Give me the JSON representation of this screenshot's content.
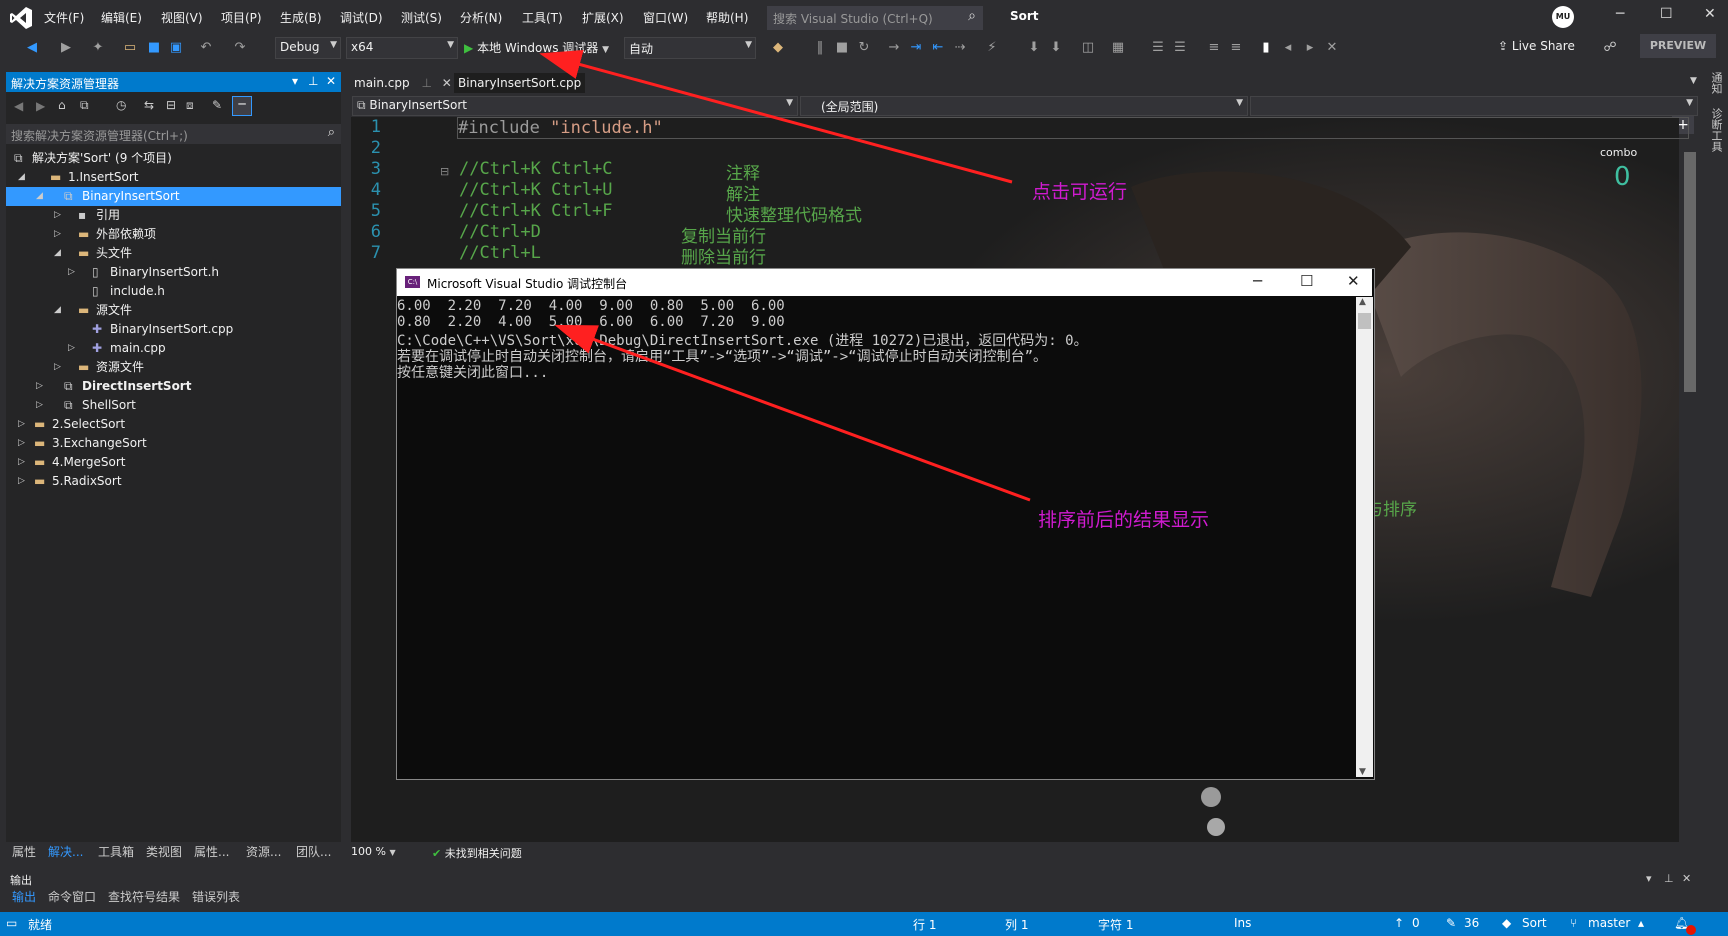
{
  "menu": {
    "items": [
      "文件(F)",
      "编辑(E)",
      "视图(V)",
      "项目(P)",
      "生成(B)",
      "调试(D)",
      "测试(S)",
      "分析(N)",
      "工具(T)",
      "扩展(X)",
      "窗口(W)",
      "帮助(H)"
    ],
    "search_placeholder": "搜索 Visual Studio (Ctrl+Q)",
    "solution_name": "Sort",
    "avatar_text": "MU"
  },
  "toolbar": {
    "config": "Debug",
    "platform": "x64",
    "run_label": "本地 Windows 调试器",
    "run_mode": "自动",
    "live_share": "Live Share",
    "preview": "PREVIEW"
  },
  "solution_explorer": {
    "title": "解决方案资源管理器",
    "search_placeholder": "搜索解决方案资源管理器(Ctrl+;)",
    "tree": [
      {
        "label": "解决方案'Sort' (9 个项目)",
        "icon": "solution-icon",
        "arrow": "",
        "bold": false,
        "selected": false
      },
      {
        "label": "1.InsertSort",
        "icon": "folder-icon",
        "arrow": "◢",
        "bold": false,
        "selected": false
      },
      {
        "label": "BinaryInsertSort",
        "icon": "project-icon",
        "arrow": "◢",
        "bold": false,
        "selected": true
      },
      {
        "label": "引用",
        "icon": "references-icon",
        "arrow": "▷",
        "bold": false,
        "selected": false
      },
      {
        "label": "外部依赖项",
        "icon": "folder-icon",
        "arrow": "▷",
        "bold": false,
        "selected": false
      },
      {
        "label": "头文件",
        "icon": "folder-icon",
        "arrow": "◢",
        "bold": false,
        "selected": false
      },
      {
        "label": "BinaryInsertSort.h",
        "icon": "header-file-icon",
        "arrow": "▷",
        "bold": false,
        "selected": false
      },
      {
        "label": "include.h",
        "icon": "header-file-icon",
        "arrow": "",
        "bold": false,
        "selected": false
      },
      {
        "label": "源文件",
        "icon": "folder-icon",
        "arrow": "◢",
        "bold": false,
        "selected": false
      },
      {
        "label": "BinaryInsertSort.cpp",
        "icon": "cpp-file-icon",
        "arrow": "",
        "bold": false,
        "selected": false
      },
      {
        "label": "main.cpp",
        "icon": "cpp-file-icon",
        "arrow": "▷",
        "bold": false,
        "selected": false
      },
      {
        "label": "资源文件",
        "icon": "folder-icon",
        "arrow": "▷",
        "bold": false,
        "selected": false
      },
      {
        "label": "DirectInsertSort",
        "icon": "project-icon",
        "arrow": "▷",
        "bold": true,
        "selected": false
      },
      {
        "label": "ShellSort",
        "icon": "project-icon",
        "arrow": "▷",
        "bold": false,
        "selected": false
      },
      {
        "label": "2.SelectSort",
        "icon": "folder-icon",
        "arrow": "▷",
        "bold": false,
        "selected": false
      },
      {
        "label": "3.ExchangeSort",
        "icon": "folder-icon",
        "arrow": "▷",
        "bold": false,
        "selected": false
      },
      {
        "label": "4.MergeSort",
        "icon": "folder-icon",
        "arrow": "▷",
        "bold": false,
        "selected": false
      },
      {
        "label": "5.RadixSort",
        "icon": "folder-icon",
        "arrow": "▷",
        "bold": false,
        "selected": false
      }
    ],
    "bottom_tabs": [
      "属性",
      "解决...",
      "工具箱",
      "类视图",
      "属性...",
      "资源...",
      "团队..."
    ]
  },
  "editor": {
    "tabs": [
      "main.cpp",
      "BinaryInsertSort.cpp"
    ],
    "nav_left": "BinaryInsertSort",
    "nav_mid": "(全局范围)",
    "line_numbers": [
      "1",
      "2",
      "3",
      "4",
      "5",
      "6",
      "7"
    ],
    "code_include_kw": "#include ",
    "code_include_str": "\"include.h\"",
    "code_lines": [
      {
        "key": "//Ctrl+K Ctrl+C",
        "desc": "注释"
      },
      {
        "key": "//Ctrl+K Ctrl+U",
        "desc": "解注"
      },
      {
        "key": "//Ctrl+K Ctrl+F",
        "desc": "快速整理代码格式"
      },
      {
        "key": "//Ctrl+D",
        "desc": "复制当前行"
      },
      {
        "key": "//Ctrl+L",
        "desc": "删除当前行"
      }
    ],
    "combo_label": "combo",
    "combo_value": "0",
    "bg_text": "与排序",
    "zoom": "100 %",
    "issues": "未找到相关问题"
  },
  "console": {
    "title": "Microsoft Visual Studio 调试控制台",
    "lines": [
      "6.00  2.20  7.20  4.00  9.00  0.80  5.00  6.00",
      "0.80  2.20  4.00  5.00  6.00  6.00  7.20  9.00",
      "C:\\Code\\C++\\VS\\Sort\\x64\\Debug\\DirectInsertSort.exe (进程 10272)已退出，返回代码为: 0。",
      "若要在调试停止时自动关闭控制台，请启用“工具”->“选项”->“调试”->“调试停止时自动关闭控制台”。",
      "按任意键关闭此窗口..."
    ]
  },
  "annotations": {
    "run_note": "点击可运行",
    "result_note": "排序前后的结果显示"
  },
  "output_panel": {
    "title": "输出",
    "tabs": [
      "输出",
      "命令窗口",
      "查找符号结果",
      "错误列表"
    ]
  },
  "statusbar": {
    "ready": "就绪",
    "line": "行 1",
    "col": "列 1",
    "char": "字符 1",
    "ins": "Ins",
    "up_count": "0",
    "edit_count": "36",
    "repo": "Sort",
    "branch": "master"
  }
}
